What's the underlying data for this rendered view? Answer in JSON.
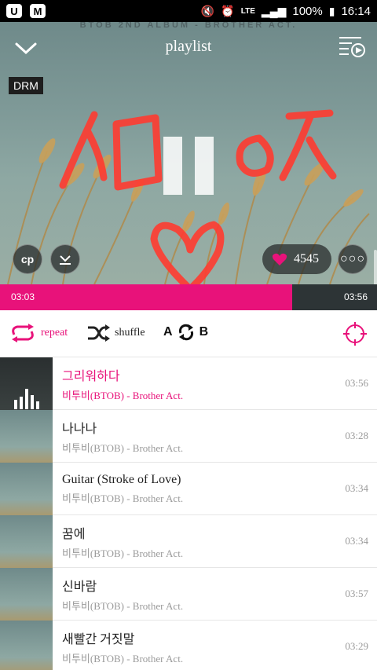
{
  "statusbar": {
    "battery": "100%",
    "time": "16:14",
    "network": "LTE",
    "left_icons": [
      "app-u-icon",
      "app-m-icon"
    ],
    "right_icons": [
      "mute-icon",
      "alarm-icon",
      "lte-icon",
      "signal-icon",
      "battery-icon"
    ]
  },
  "header": {
    "album_tag": "BTOB 2ND ALBUM - BROTHER ACT.",
    "title": "playlist",
    "back_icon": "chevron-down-icon",
    "queue_icon": "playlist-play-icon"
  },
  "hero": {
    "drm_badge": "DRM",
    "likes": "4545",
    "state": "playing",
    "left_buttons": [
      "cp-icon",
      "download-icon"
    ],
    "more_icon": "more-dots-icon",
    "scribble_text": "ㅅㅁㅇㅈ"
  },
  "progress": {
    "current": "03:03",
    "total": "03:56",
    "fraction": 0.775
  },
  "controls": {
    "repeat_label": "repeat",
    "shuffle_label": "shuffle",
    "ab_left": "A",
    "ab_right": "B"
  },
  "tracks": [
    {
      "title": "그리워하다",
      "artist": "비투비(BTOB) - Brother Act.",
      "duration": "03:56",
      "active": true
    },
    {
      "title": "나나나",
      "artist": "비투비(BTOB) - Brother Act.",
      "duration": "03:28",
      "active": false
    },
    {
      "title": "Guitar (Stroke of Love)",
      "artist": "비투비(BTOB) - Brother Act.",
      "duration": "03:34",
      "active": false
    },
    {
      "title": "꿈에",
      "artist": "비투비(BTOB) - Brother Act.",
      "duration": "03:34",
      "active": false
    },
    {
      "title": "신바람",
      "artist": "비투비(BTOB) - Brother Act.",
      "duration": "03:57",
      "active": false
    },
    {
      "title": "새빨간 거짓말",
      "artist": "비투비(BTOB) - Brother Act.",
      "duration": "03:29",
      "active": false
    }
  ],
  "colors": {
    "accent": "#e8127a",
    "progress_bg": "#2d3436",
    "scribble": "#ff3b30"
  }
}
